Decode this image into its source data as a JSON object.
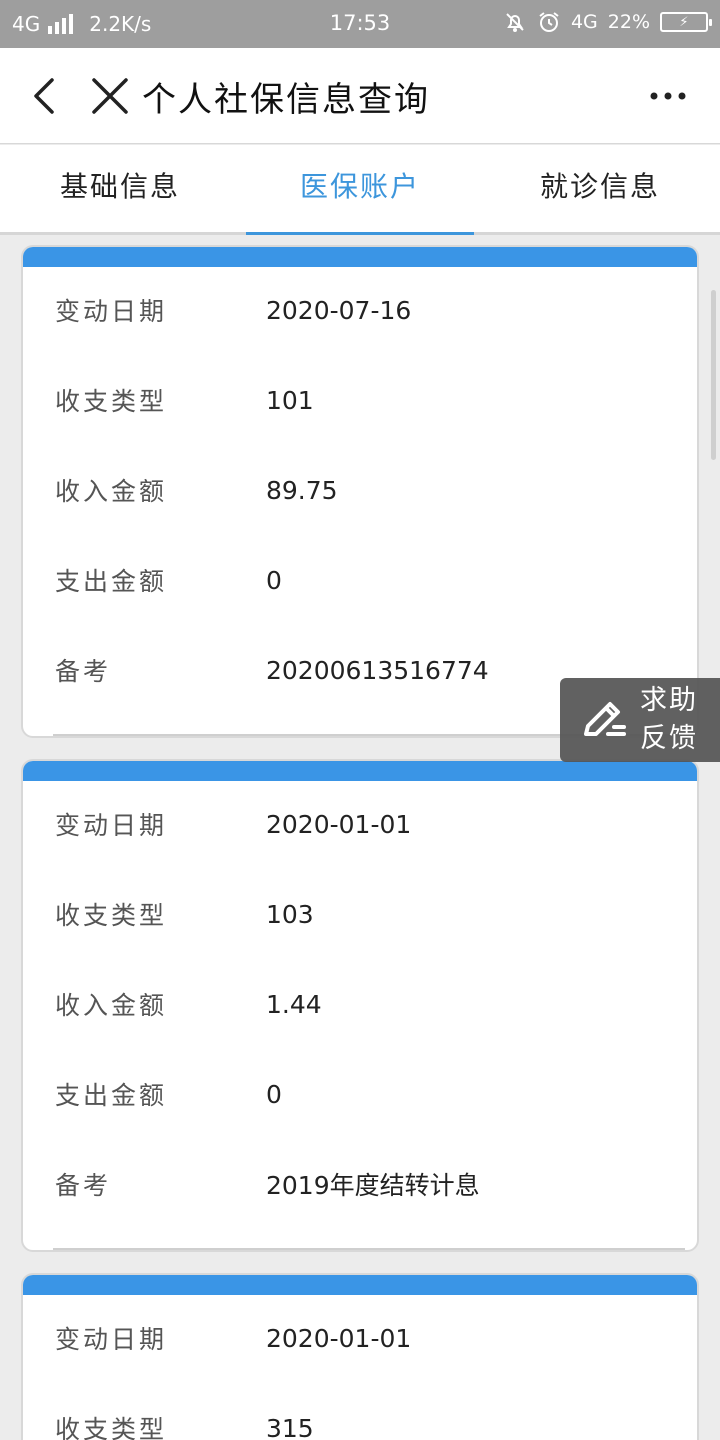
{
  "status_bar": {
    "network": "4G",
    "speed": "2.2K/s",
    "time": "17:53",
    "network_right": "4G",
    "battery_percent": "22%",
    "icons": [
      "signal-icon",
      "mute-bell-icon",
      "alarm-icon",
      "battery-charging-icon"
    ]
  },
  "navbar": {
    "title": "个人社保信息查询",
    "icons": [
      "back-arrow-icon",
      "close-icon",
      "more-dots-icon"
    ]
  },
  "tabs": [
    {
      "label": "基础信息",
      "active": false
    },
    {
      "label": "医保账户",
      "active": true
    },
    {
      "label": "就诊信息",
      "active": false
    }
  ],
  "records": [
    {
      "rows": [
        {
          "label": "变动日期",
          "value": "2020-07-16"
        },
        {
          "label": "收支类型",
          "value": "101"
        },
        {
          "label": "收入金额",
          "value": "89.75"
        },
        {
          "label": "支出金额",
          "value": "0"
        },
        {
          "label": "备考",
          "value": "20200613516774"
        }
      ]
    },
    {
      "rows": [
        {
          "label": "变动日期",
          "value": "2020-01-01"
        },
        {
          "label": "收支类型",
          "value": "103"
        },
        {
          "label": "收入金额",
          "value": "1.44"
        },
        {
          "label": "支出金额",
          "value": "0"
        },
        {
          "label": "备考",
          "value": "2019年度结转计息"
        }
      ]
    },
    {
      "rows": [
        {
          "label": "变动日期",
          "value": "2020-01-01"
        },
        {
          "label": "收支类型",
          "value": "315"
        }
      ]
    }
  ],
  "help_button": {
    "line1": "求助",
    "line2": "反馈",
    "icon": "edit-pencil-icon"
  },
  "colors": {
    "accent": "#3d96dc",
    "card_header": "#3a95e6",
    "status_bar": "#9e9e9e",
    "background": "#ececec"
  }
}
